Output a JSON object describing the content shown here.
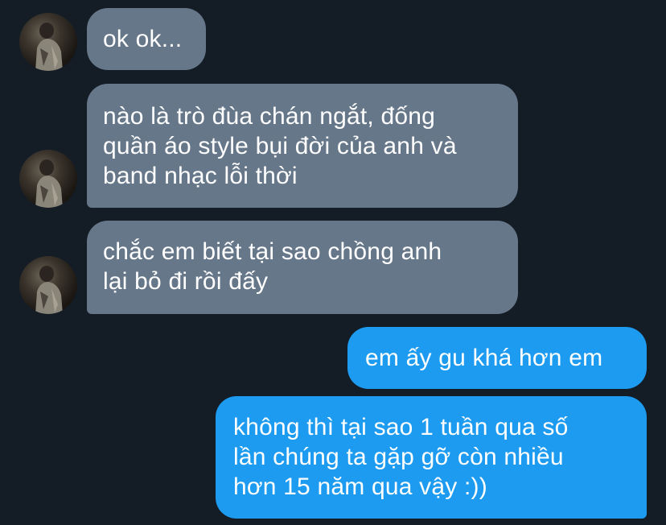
{
  "conversation": {
    "messages": [
      {
        "direction": "incoming",
        "lines": [
          "ok ok..."
        ]
      },
      {
        "direction": "incoming",
        "lines": [
          "nào là trò đùa chán ngắt, đống",
          "quần áo style bụi đời của anh và",
          "band nhạc lỗi thời"
        ]
      },
      {
        "direction": "incoming",
        "lines": [
          "chắc em biết tại sao chồng anh",
          "lại bỏ đi rồi đấy"
        ]
      },
      {
        "direction": "outgoing",
        "lines": [
          "em ấy gu khá hơn em"
        ]
      },
      {
        "direction": "outgoing",
        "lines": [
          "không thì tại sao 1 tuần qua số",
          "lần chúng ta gặp gỡ còn nhiều",
          "hơn 15 năm qua vậy :))"
        ]
      }
    ]
  },
  "colors": {
    "background": "#141c26",
    "incoming_bubble": "#66778a",
    "outgoing_bubble": "#1d9bf0",
    "text": "#ffffff"
  },
  "icons": {
    "contact_avatar": "avatar-photo"
  }
}
